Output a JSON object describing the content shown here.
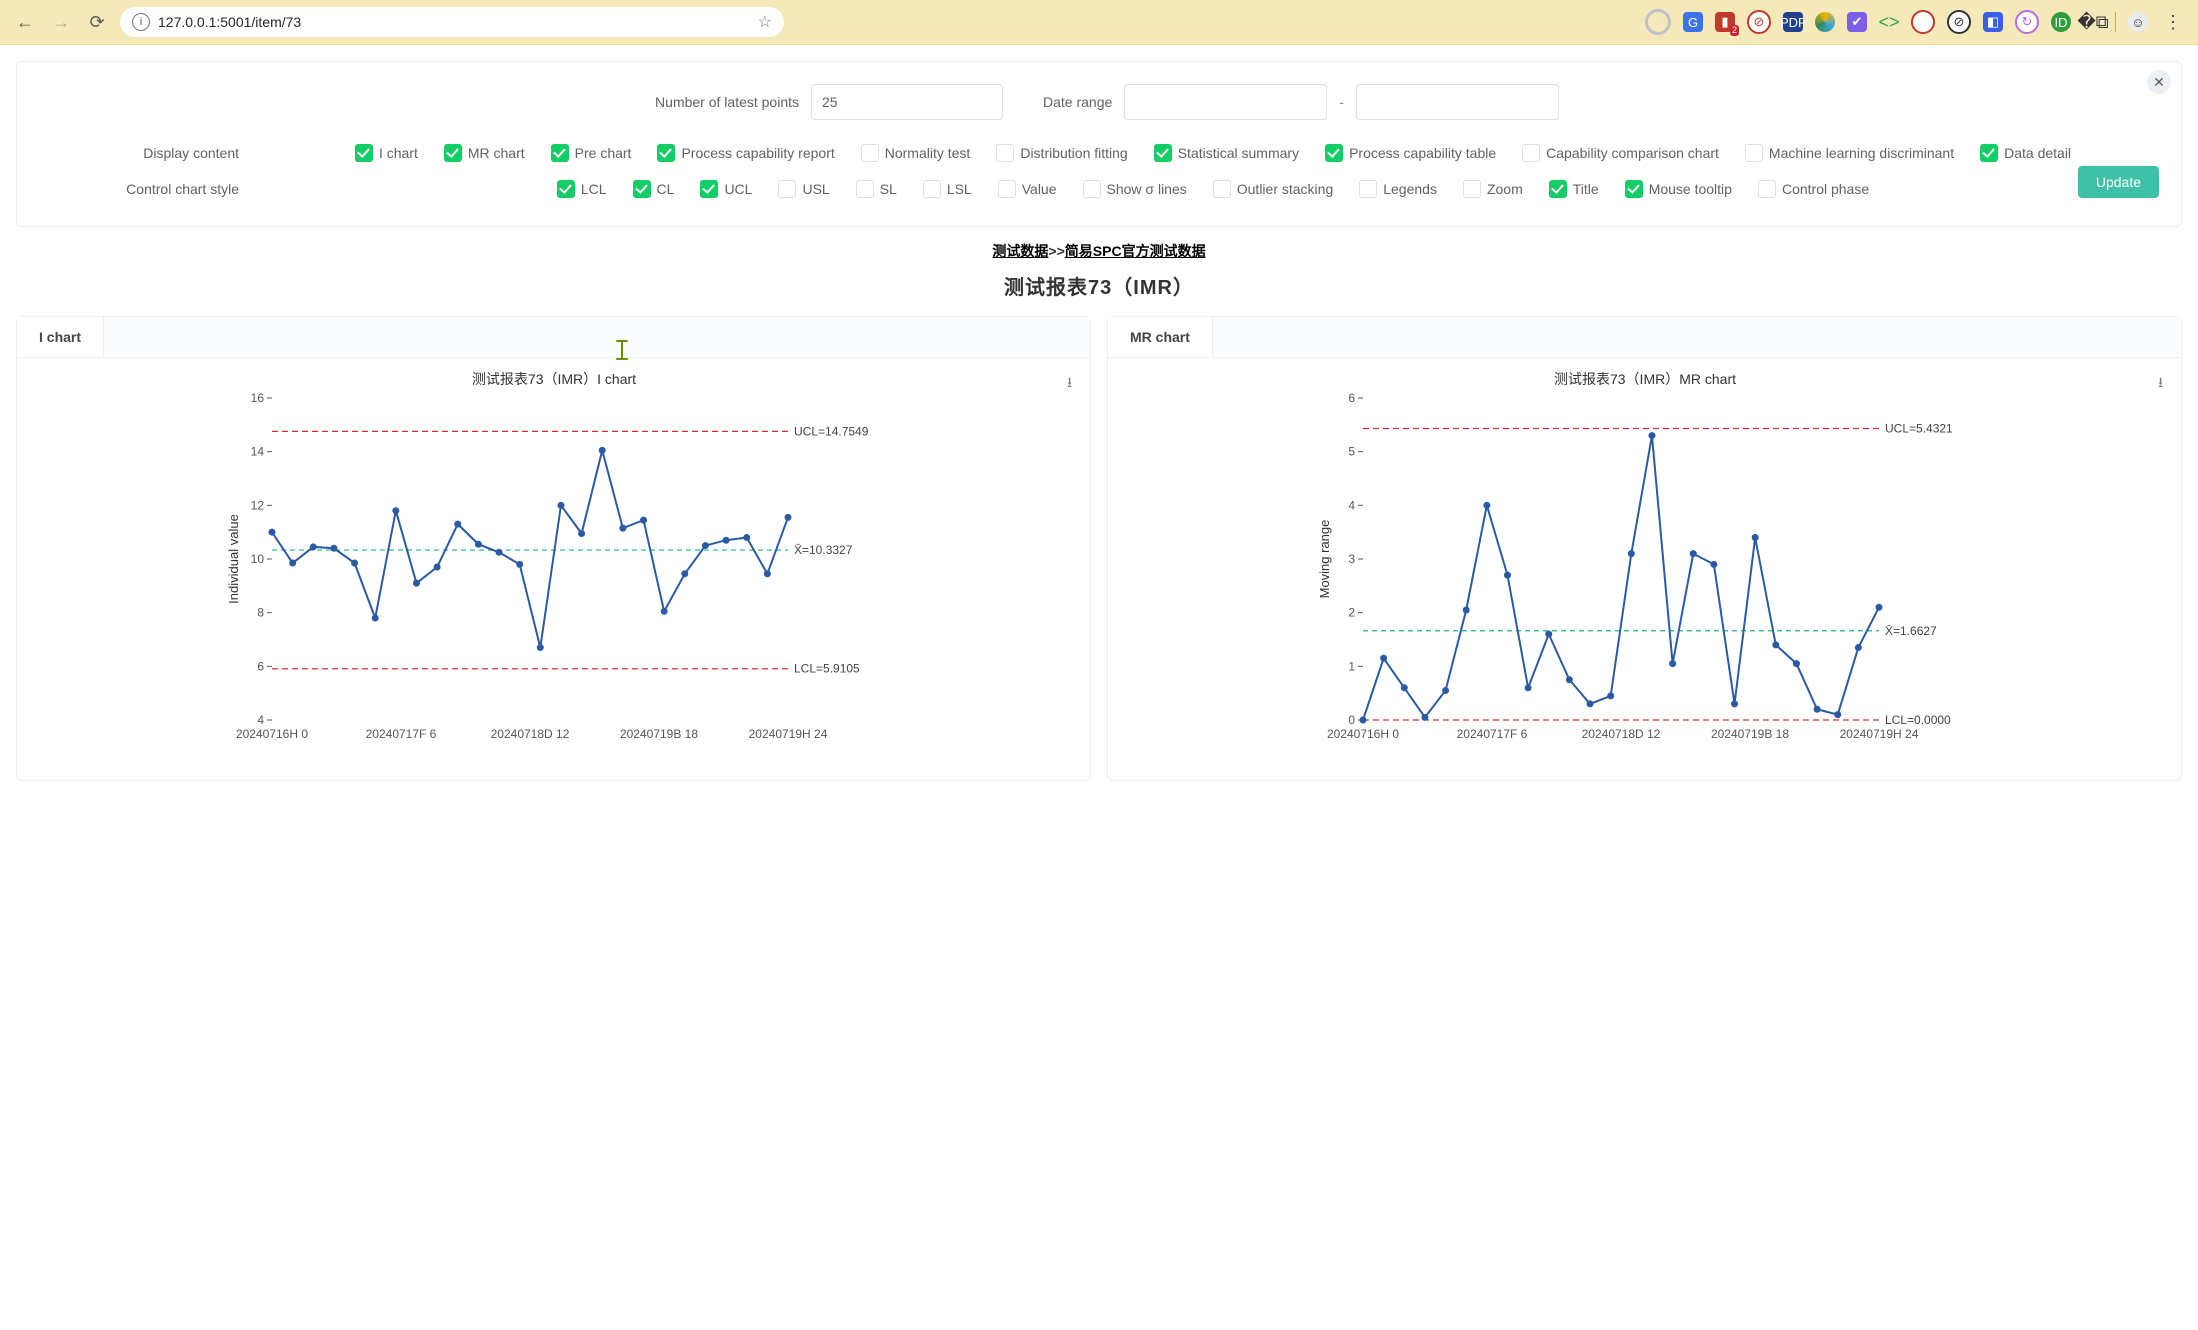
{
  "browser": {
    "url": "127.0.0.1:5001/item/73",
    "ext_badge": "2"
  },
  "form": {
    "num_points_label": "Number of latest points",
    "num_points_value": "25",
    "date_range_label": "Date range",
    "date_from": "",
    "date_to": "",
    "dash": "-",
    "display_content_label": "Display content",
    "display_content": [
      {
        "label": "I chart",
        "checked": true
      },
      {
        "label": "MR chart",
        "checked": true
      },
      {
        "label": "Pre chart",
        "checked": true
      },
      {
        "label": "Process capability report",
        "checked": true
      },
      {
        "label": "Normality test",
        "checked": false
      },
      {
        "label": "Distribution fitting",
        "checked": false
      },
      {
        "label": "Statistical summary",
        "checked": true
      },
      {
        "label": "Process capability table",
        "checked": true
      },
      {
        "label": "Capability comparison chart",
        "checked": false
      },
      {
        "label": "Machine learning discriminant",
        "checked": false
      },
      {
        "label": "Data detail",
        "checked": true
      }
    ],
    "control_chart_label": "Control chart style",
    "control_chart": [
      {
        "label": "LCL",
        "checked": true
      },
      {
        "label": "CL",
        "checked": true
      },
      {
        "label": "UCL",
        "checked": true
      },
      {
        "label": "USL",
        "checked": false
      },
      {
        "label": "SL",
        "checked": false
      },
      {
        "label": "LSL",
        "checked": false
      },
      {
        "label": "Value",
        "checked": false
      },
      {
        "label": "Show σ lines",
        "checked": false
      },
      {
        "label": "Outlier stacking",
        "checked": false
      },
      {
        "label": "Legends",
        "checked": false
      },
      {
        "label": "Zoom",
        "checked": false
      },
      {
        "label": "Title",
        "checked": true
      },
      {
        "label": "Mouse tooltip",
        "checked": true
      },
      {
        "label": "Control phase",
        "checked": false
      }
    ],
    "update_button": "Update"
  },
  "header": {
    "breadcrumb_a": "测试数据",
    "breadcrumb_sep": ">>",
    "breadcrumb_b": "简易SPC官方测试数据",
    "title": "测试报表73（IMR）"
  },
  "charts": {
    "i_tab": "I chart",
    "mr_tab": "MR chart"
  },
  "chart_data": [
    {
      "id": "i",
      "type": "line",
      "title": "测试报表73（IMR）I chart",
      "ylabel": "Individual value",
      "ylim": [
        4,
        16
      ],
      "yticks": [
        4,
        6,
        8,
        10,
        12,
        14,
        16
      ],
      "x_categories_shown": [
        "20240716H 0",
        "20240717F 6",
        "20240718D 12",
        "20240719B 18",
        "20240719H 24"
      ],
      "values": [
        11.0,
        9.85,
        10.45,
        10.4,
        9.85,
        7.8,
        11.8,
        9.1,
        9.7,
        11.3,
        10.55,
        10.25,
        9.8,
        6.7,
        12.0,
        10.95,
        14.05,
        11.15,
        11.45,
        8.05,
        9.45,
        10.5,
        10.7,
        10.8,
        9.45,
        11.55
      ],
      "n": 26,
      "UCL": 14.7549,
      "CL": 10.3327,
      "CL_label": "X̄=10.3327",
      "LCL": 5.9105,
      "UCL_label": "UCL=14.7549",
      "LCL_label": "LCL=5.9105"
    },
    {
      "id": "mr",
      "type": "line",
      "title": "测试报表73（IMR）MR chart",
      "ylabel": "Moving range",
      "ylim": [
        0,
        6
      ],
      "yticks": [
        0,
        1,
        2,
        3,
        4,
        5,
        6
      ],
      "x_categories_shown": [
        "20240716H 0",
        "20240717F 6",
        "20240718D 12",
        "20240719B 18",
        "20240719H 24"
      ],
      "values": [
        0.0,
        1.15,
        0.6,
        0.05,
        0.55,
        2.05,
        4.0,
        2.7,
        0.6,
        1.6,
        0.75,
        0.3,
        0.45,
        3.1,
        5.3,
        1.05,
        3.1,
        2.9,
        0.3,
        3.4,
        1.4,
        1.05,
        0.2,
        0.1,
        1.35,
        2.1
      ],
      "n": 26,
      "UCL": 5.4321,
      "CL": 1.6627,
      "CL_label": "X̄=1.6627",
      "LCL": 0.0,
      "UCL_label": "UCL=5.4321",
      "LCL_label": "LCL=0.0000"
    }
  ]
}
